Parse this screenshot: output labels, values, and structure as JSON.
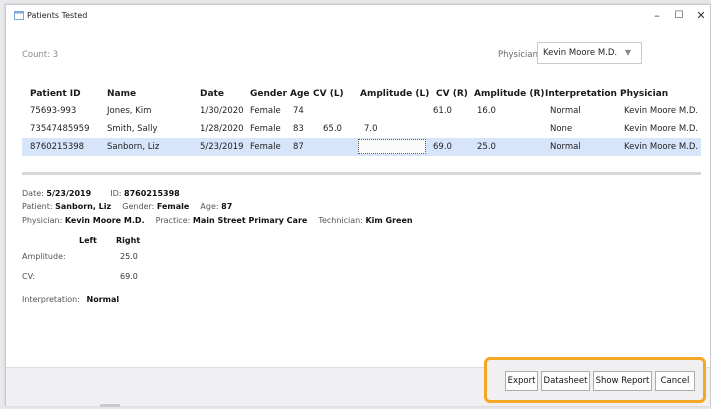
{
  "window": {
    "title": "Patients Tested"
  },
  "count_label": "Count: 3",
  "physician_filter": {
    "label": "Physician:",
    "value": "Kevin Moore M.D."
  },
  "table": {
    "headers": [
      "Patient ID",
      "Name",
      "Date",
      "Gender",
      "Age",
      "CV (L)",
      "Amplitude (L)",
      "CV (R)",
      "Amplitude (R)",
      "Interpretation",
      "Physician"
    ],
    "rows": [
      [
        "75693-993",
        "Jones, Kim",
        "1/30/2020",
        "Female",
        "74",
        "",
        "",
        "61.0",
        "16.0",
        "Normal",
        "Kevin Moore M.D."
      ],
      [
        "73547485959",
        "Smith, Sally",
        "1/28/2020",
        "Female",
        "83",
        "65.0",
        "7.0",
        "",
        "",
        "None",
        "Kevin Moore M.D."
      ],
      [
        "8760215398",
        "Sanborn, Liz",
        "5/23/2019",
        "Female",
        "87",
        "",
        "",
        "69.0",
        "25.0",
        "Normal",
        "Kevin Moore M.D."
      ]
    ],
    "selected_row": 2
  },
  "detail": {
    "date_label": "Date:",
    "date": "5/23/2019",
    "id_label": "ID:",
    "id": "8760215398",
    "patient_label": "Patient:",
    "patient": "Sanborn, Liz",
    "gender_label": "Gender:",
    "gender": "Female",
    "age_label": "Age:",
    "age": "87",
    "physician_label": "Physician:",
    "physician": "Kevin Moore M.D.",
    "practice_label": "Practice:",
    "practice": "Main Street Primary Care",
    "technician_label": "Technician:",
    "technician": "Kim Green",
    "left_header": "Left",
    "right_header": "Right",
    "amplitude_label": "Amplitude:",
    "amplitude_right": "25.0",
    "cv_label": "CV:",
    "cv_right": "69.0",
    "interpretation_label": "Interpretation:",
    "interpretation": "Normal"
  },
  "buttons": {
    "export": "Export",
    "datasheet": "Datasheet",
    "show_report": "Show Report",
    "cancel": "Cancel"
  },
  "colors": {
    "selected_row": "#d7e5fa",
    "highlight_border": "#f5a623"
  }
}
